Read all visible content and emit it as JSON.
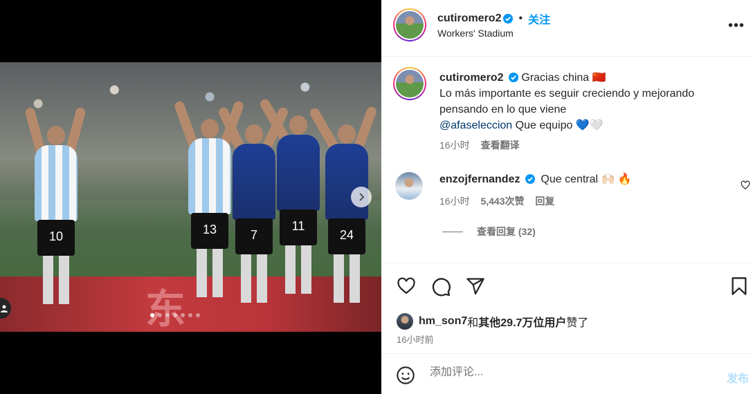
{
  "post": {
    "username": "cutiromero2",
    "follow_label": "关注",
    "location": "Workers' Stadium",
    "more_label": "•••"
  },
  "media": {
    "banner_text": "东",
    "jersey_numbers": [
      "10",
      "13",
      "7",
      "11",
      "24"
    ],
    "dot_count": 7,
    "active_dot": 0
  },
  "caption": {
    "username": "cutiromero2",
    "line1": "Gracias china 🇨🇳",
    "line2": "Lo más importante es seguir creciendo y mejorando pensando en lo que viene",
    "mention": "@afaseleccion",
    "line3_rest": " Que equipo 💙🤍",
    "time": "16小时",
    "translate": "查看翻译"
  },
  "comment": {
    "username": "enzojfernandez",
    "text": "Que central 🙌🏻 🔥",
    "time": "16小时",
    "likes": "5,443次赞",
    "reply": "回复",
    "view_replies": "查看回复 (32)"
  },
  "likes": {
    "user": "hm_son7",
    "connector": "和",
    "others": "其他29.7万位用户",
    "suffix": "赞了",
    "time": "16小时前"
  },
  "add_comment": {
    "placeholder": "添加评论...",
    "post_label": "发布"
  },
  "colors": {
    "accent": "#0095f6",
    "verified": "#0095f6",
    "post_disabled": "#b2dffc"
  }
}
